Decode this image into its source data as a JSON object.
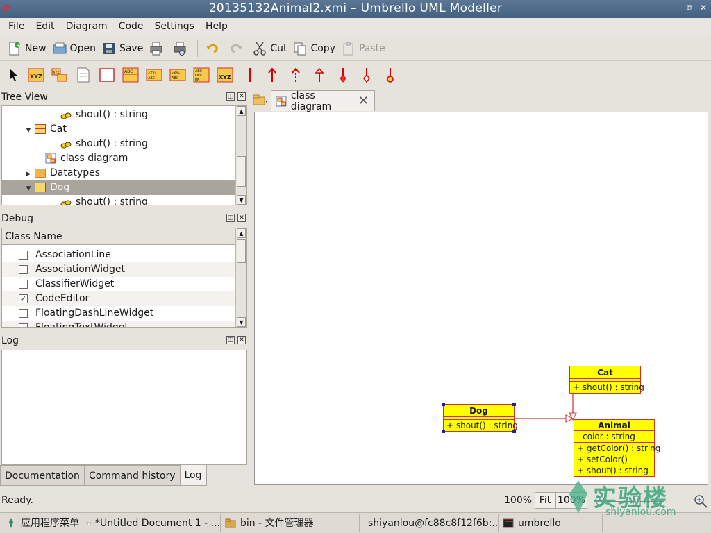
{
  "window": {
    "title": "20135132Animal2.xmi – Umbrello UML Modeller",
    "buttons": [
      "_",
      "⧉",
      "✕"
    ]
  },
  "menu": [
    "File",
    "Edit",
    "Diagram",
    "Code",
    "Settings",
    "Help"
  ],
  "toolbar": {
    "new": "New",
    "open": "Open",
    "save": "Save",
    "cut": "Cut",
    "copy": "Copy",
    "paste": "Paste"
  },
  "tree_view": {
    "title": "Tree View",
    "rows": [
      {
        "label": "shout() : string",
        "kind": "op",
        "indent": 84
      },
      {
        "label": "Cat",
        "kind": "class",
        "indent": 48,
        "expander": "▼"
      },
      {
        "label": "shout() : string",
        "kind": "op",
        "indent": 84
      },
      {
        "label": "class diagram",
        "kind": "diagram",
        "indent": 62
      },
      {
        "label": "Datatypes",
        "kind": "folder",
        "indent": 48,
        "expander": "▶"
      },
      {
        "label": "Dog",
        "kind": "class",
        "indent": 48,
        "expander": "▼",
        "selected": true
      },
      {
        "label": "shout() : string",
        "kind": "op",
        "indent": 84
      }
    ]
  },
  "debug": {
    "title": "Debug",
    "column": "Class Name",
    "rows": [
      {
        "label": "AssociationLine",
        "checked": false
      },
      {
        "label": "AssociationWidget",
        "checked": false
      },
      {
        "label": "ClassifierWidget",
        "checked": false
      },
      {
        "label": "CodeEditor",
        "checked": true
      },
      {
        "label": "FloatingDashLineWidget",
        "checked": false
      },
      {
        "label": "FloatingTextWidget",
        "checked": false
      }
    ]
  },
  "log": {
    "title": "Log"
  },
  "bottom_tabs": [
    {
      "label": "Documentation",
      "active": false
    },
    {
      "label": "Command history",
      "active": false
    },
    {
      "label": "Log",
      "active": true
    }
  ],
  "diagram_tab": {
    "label": "class diagram"
  },
  "uml": {
    "cat": {
      "name": "Cat",
      "ops": [
        "+ shout() : string"
      ]
    },
    "dog": {
      "name": "Dog",
      "ops": [
        "+ shout() : string"
      ]
    },
    "animal": {
      "name": "Animal",
      "attrs": [
        "- color : string"
      ],
      "ops": [
        "+ getColor() : string",
        "+ setColor()",
        "+ shout() : string"
      ]
    }
  },
  "status": {
    "text": "Ready.",
    "zoom": "100%",
    "fit": "Fit",
    "zoom_field": "100%"
  },
  "taskbar": [
    {
      "label": "应用程序菜单",
      "kind": "menu"
    },
    {
      "label": "*Untitled Document 1 - ...",
      "kind": "editor"
    },
    {
      "label": "bin - 文件管理器",
      "kind": "folder"
    },
    {
      "label": "shiyanlou@fc88c8f12f6b:...",
      "kind": "terminal"
    },
    {
      "label": "umbrello",
      "kind": "terminal"
    }
  ],
  "watermark": {
    "text": "实验楼",
    "url": "shiyanlou.com"
  },
  "colors": {
    "uml_fill": "#ffff00",
    "uml_border": "#d03030",
    "titlebar": "#4d6a8a",
    "selection": "#a9a49c"
  }
}
